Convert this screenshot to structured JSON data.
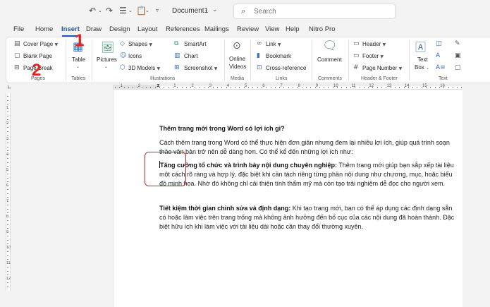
{
  "titlebar": {
    "undo_icon": "undo-icon",
    "redo_icon": "redo-icon",
    "doc_title": "Document1",
    "doc_title_sep": "-",
    "search_placeholder": "Search"
  },
  "menu": {
    "tabs": [
      "File",
      "Home",
      "Insert",
      "Draw",
      "Design",
      "Layout",
      "References",
      "Mailings",
      "Review",
      "View",
      "Help",
      "Nitro Pro"
    ],
    "active": "Insert"
  },
  "ribbon": {
    "pages": {
      "cover": "Cover Page",
      "blank": "Blank Page",
      "break": "Page Break",
      "label": "Pages"
    },
    "tables": {
      "table": "Table",
      "label": "Tables"
    },
    "illustrations": {
      "pictures": "Pictures",
      "shapes": "Shapes",
      "icons": "Icons",
      "models": "3D Models",
      "smartart": "SmartArt",
      "chart": "Chart",
      "screenshot": "Screenshot",
      "label": "Illustrations"
    },
    "media": {
      "video_line1": "Online",
      "video_line2": "Videos",
      "label": "Media"
    },
    "links": {
      "link": "Link",
      "bookmark": "Bookmark",
      "cross": "Cross-reference",
      "label": "Links"
    },
    "comments": {
      "comment": "Comment",
      "label": "Comments"
    },
    "header_footer": {
      "header": "Header",
      "footer": "Footer",
      "page_number": "Page Number",
      "label": "Header & Footer"
    },
    "text": {
      "text_box_line1": "Text",
      "text_box_line2": "Box",
      "label": "Text"
    }
  },
  "annotations": {
    "one": "1",
    "two": "2"
  },
  "ruler": {
    "numbers": [
      "1",
      "2",
      "1",
      "2",
      "3",
      "4",
      "5",
      "6",
      "7",
      "8",
      "9",
      "10",
      "11",
      "12",
      "13",
      "14",
      "15",
      "16"
    ],
    "vnumbers": [
      "1",
      "2",
      "3",
      "4",
      "5",
      "6",
      "7",
      "8",
      "9",
      "10",
      "11",
      "12"
    ]
  },
  "document": {
    "heading": "Thêm trang mới trong Word có lợi ích gì?",
    "p1": "Cách thêm trang trong Word có thể thực hiện đơn giản nhưng đem lại nhiều lợi ích, giúp quá trình soạn thảo văn bản trở nên dễ dàng hơn. Có thể kể đến những lợi ích như:",
    "p2_bold": "Tăng cường tổ chức và trình bày nội dung chuyên nghiệp:",
    "p2_text": " Thêm trang mới giúp bạn sắp xếp tài liệu một cách rõ ràng và hợp lý, đặc biệt khi cần tách riêng từng phần nội dung như chương, mục, hoặc biểu đồ minh họa. Nhờ đó không chỉ cải thiện tính thẩm mỹ mà còn tạo trải nghiệm dễ đọc cho người xem.",
    "p3_bold": "Tiết kiệm thời gian chỉnh sửa và định dạng:",
    "p3_text": " Khi tạo trang mới, bạn có thể áp dụng các định dạng sẵn có hoặc làm việc trên trang trống mà không ảnh hưởng đến bố cục của các nội dung đã hoàn thành. Đặc biệt hữu ích khi làm việc với tài liệu dài hoặc cần thay đổi thường xuyên."
  },
  "colors": {
    "accent": "#185abd",
    "annotation": "#e0201f"
  }
}
